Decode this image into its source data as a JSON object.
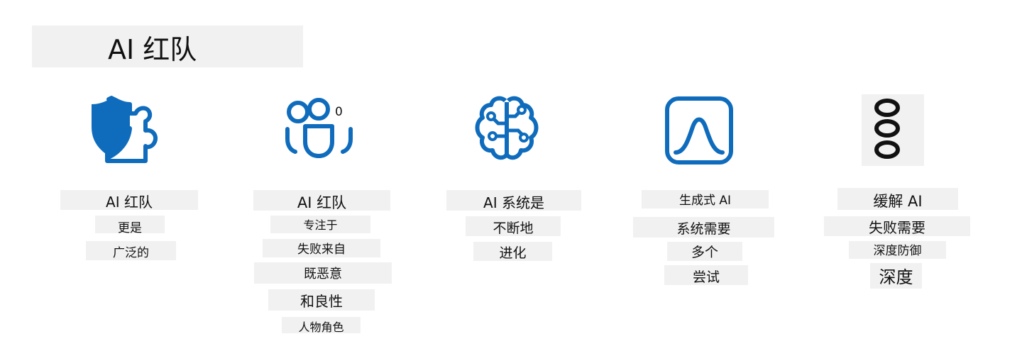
{
  "title": "AI 红队",
  "palette": {
    "icon_blue": "#0f6cbd",
    "label_bg": "#f1f1f1",
    "text": "#111111"
  },
  "columns": [
    {
      "icon": "shield-puzzle-icon",
      "lines": [
        "AI 红队",
        "更是",
        "广泛的"
      ]
    },
    {
      "icon": "people-team-icon",
      "badge": "0",
      "lines": [
        "AI 红队",
        "专注于",
        "失败来自",
        "既恶意",
        "和良性",
        "人物角色"
      ]
    },
    {
      "icon": "brain-circuit-icon",
      "lines": [
        "AI 系统是",
        "不断地",
        "进化"
      ]
    },
    {
      "icon": "bell-curve-icon",
      "lines": [
        "生成式 AI",
        "系统需要",
        "多个",
        "尝试"
      ]
    },
    {
      "icon": "stacked-circles-icon",
      "icon_text": "000",
      "lines": [
        "缓解 AI",
        "失败需要",
        "深度防御",
        "深度"
      ]
    }
  ]
}
